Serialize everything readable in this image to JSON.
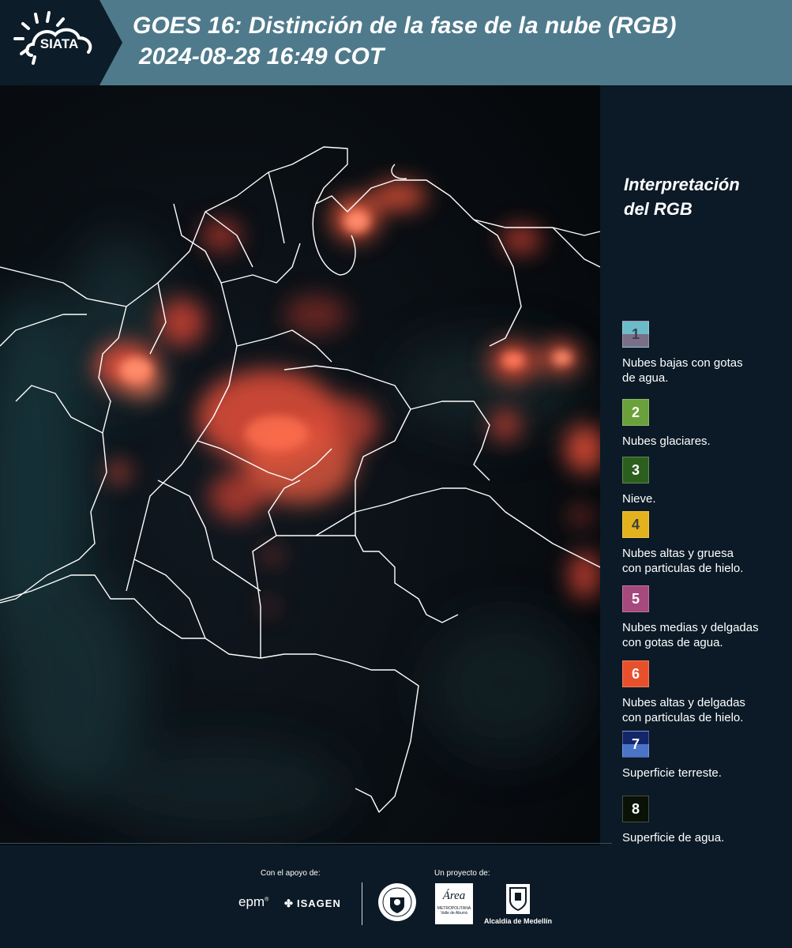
{
  "header": {
    "logo_text": "SIATA",
    "title_line1": "GOES 16: Distinción de la fase de la nube (RGB)",
    "title_line2": "2024-08-28 16:49 COT",
    "background_color": "#4f7a8c"
  },
  "legend": {
    "title_line1": "Interpretación",
    "title_line2": "del RGB",
    "items": [
      {
        "number": "1",
        "label": "Nubes bajas con gotas\nde agua.",
        "color_top": "#6bbcc8",
        "color_bottom": "#7a6e88",
        "number_color": "#3e3e4e"
      },
      {
        "number": "2",
        "label": "Nubes glaciares.",
        "color_top": "#6aa13a",
        "color_bottom": "#6aa13a",
        "number_color": "#ffffff"
      },
      {
        "number": "3",
        "label": "Nieve.",
        "color_top": "#2c5f1e",
        "color_bottom": "#2c5f1e",
        "number_color": "#ffffff"
      },
      {
        "number": "4",
        "label": "Nubes altas y gruesa\ncon particulas de hielo.",
        "color_top": "#e3b21c",
        "color_bottom": "#e3b21c",
        "number_color": "#3e3e3e"
      },
      {
        "number": "5",
        "label": "Nubes medias y delgadas\ncon gotas de agua.",
        "color_top": "#a6497c",
        "color_bottom": "#a6497c",
        "number_color": "#ffffff"
      },
      {
        "number": "6",
        "label": "Nubes altas y delgadas\ncon particulas de hielo.",
        "color_top": "#e8502c",
        "color_bottom": "#e8502c",
        "number_color": "#ffffff"
      },
      {
        "number": "7",
        "label": "Superficie terreste.",
        "color_top": "#14266a",
        "color_bottom": "#4a74c8",
        "number_color": "#ffffff"
      },
      {
        "number": "8",
        "label": "Superficie de agua.",
        "color_top": "#0a1208",
        "color_bottom": "#0a1208",
        "number_color": "#ffffff"
      }
    ]
  },
  "footer": {
    "support_text": "Con el apoyo de:",
    "project_text": "Un proyecto de:",
    "sponsor_epm": "epm",
    "sponsor_isagen": "ISAGEN",
    "partner_area_line1": "Área",
    "partner_area_line2": "METROPOLITANA",
    "partner_area_line3": "Valle de Aburrá",
    "partner_alcaldia": "Alcaldía de Medellín"
  }
}
